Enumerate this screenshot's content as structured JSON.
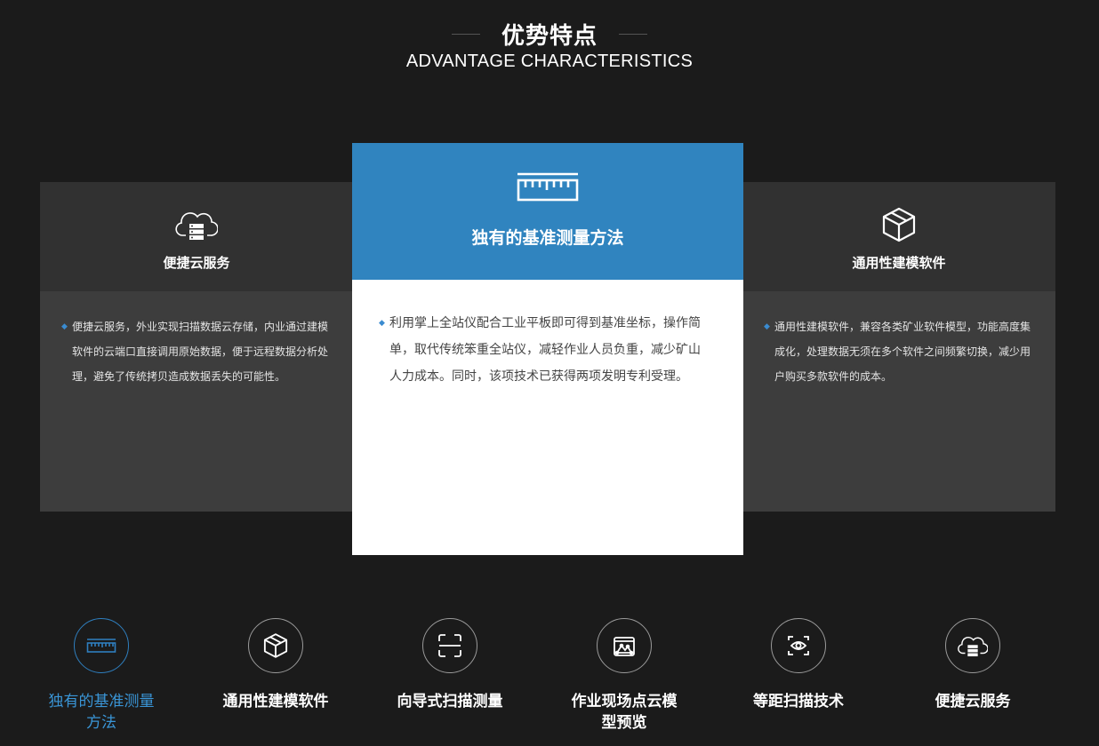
{
  "header": {
    "title_cn": "优势特点",
    "title_en": "ADVANTAGE CHARACTERISTICS"
  },
  "cards": {
    "left": {
      "icon": "cloud-server-icon",
      "title": "便捷云服务",
      "desc": "便捷云服务，外业实现扫描数据云存储，内业通过建模软件的云端口直接调用原始数据，便于远程数据分析处理，避免了传统拷贝造成数据丢失的可能性。"
    },
    "center": {
      "icon": "ruler-icon",
      "title": "独有的基准测量方法",
      "desc": "利用掌上全站仪配合工业平板即可得到基准坐标，操作简单，取代传统笨重全站仪，减轻作业人员负重，减少矿山人力成本。同时，该项技术已获得两项发明专利受理。"
    },
    "right": {
      "icon": "cube-icon",
      "title": "通用性建模软件",
      "desc": "通用性建模软件，兼容各类矿业软件模型，功能高度集成化，处理数据无须在多个软件之间频繁切换，减少用户购买多款软件的成本。"
    }
  },
  "tabs": [
    {
      "label": "独有的基准测量方法",
      "icon": "ruler-icon",
      "active": true
    },
    {
      "label": "通用性建模软件",
      "icon": "cube-icon",
      "active": false
    },
    {
      "label": "向导式扫描测量",
      "icon": "scan-frame-icon",
      "active": false
    },
    {
      "label": "作业现场点云模型预览",
      "icon": "point-cloud-preview-icon",
      "active": false
    },
    {
      "label": "等距扫描技术",
      "icon": "eye-scan-icon",
      "active": false
    },
    {
      "label": "便捷云服务",
      "icon": "cloud-server-icon",
      "active": false
    }
  ],
  "colors": {
    "accent": "#3084bf",
    "active_label": "#3a95d6",
    "background": "#1b1b1b",
    "side_card_top": "#313131",
    "side_card_body": "#3d3d3d"
  }
}
